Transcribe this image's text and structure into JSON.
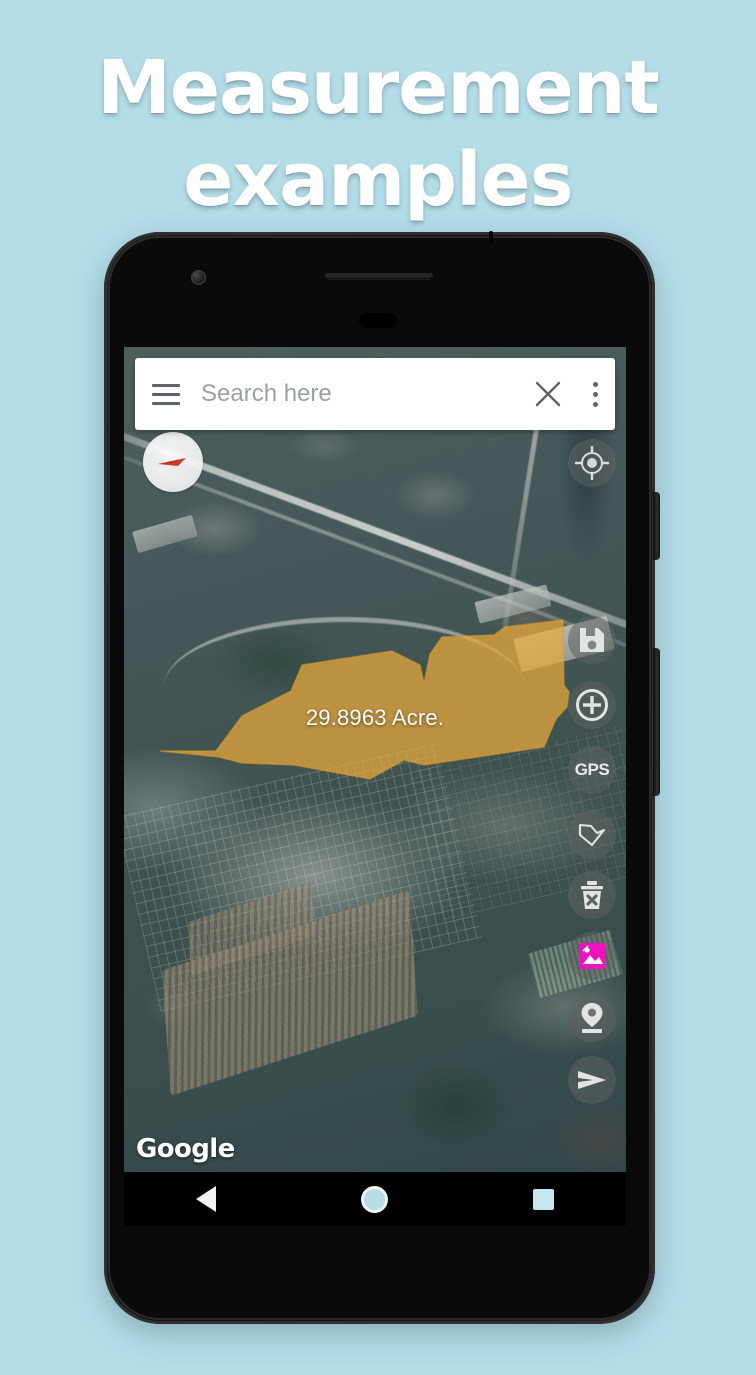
{
  "page": {
    "background_color": "#b4dde8",
    "title_lines": [
      "Measurement",
      "examples"
    ]
  },
  "app": {
    "search": {
      "placeholder": "Search here",
      "value": "",
      "menu_icon": "hamburger-menu-icon",
      "clear_icon": "close-x-icon",
      "overflow_icon": "more-vertical-icon"
    },
    "map": {
      "provider_watermark": "Google",
      "compass_icon": "compass-needle-icon",
      "measurement": {
        "label": "29.8963 Acre.",
        "value": 29.8963,
        "unit": "Acre.",
        "polygon_fill": "#e8a93c",
        "polygon_opacity": 0.72
      }
    },
    "toolbar": [
      {
        "name": "my-location",
        "icon": "crosshair-target-icon",
        "label": ""
      },
      {
        "name": "save",
        "icon": "floppy-disk-save-icon",
        "label": ""
      },
      {
        "name": "add-point",
        "icon": "circle-plus-icon",
        "label": ""
      },
      {
        "name": "gps",
        "icon": "gps-text-icon",
        "label": "GPS"
      },
      {
        "name": "polygon",
        "icon": "polygon-outline-icon",
        "label": ""
      },
      {
        "name": "delete",
        "icon": "trash-x-icon",
        "label": ""
      },
      {
        "name": "map-layers",
        "icon": "image-photo-icon",
        "label": "",
        "accent": "#f012be"
      },
      {
        "name": "place-marker",
        "icon": "location-pin-icon",
        "label": ""
      },
      {
        "name": "send-share",
        "icon": "send-arrow-icon",
        "label": ""
      }
    ],
    "navbar": {
      "back_icon": "triangle-back-icon",
      "home_icon": "circle-home-icon",
      "recents_icon": "square-recents-icon"
    }
  }
}
